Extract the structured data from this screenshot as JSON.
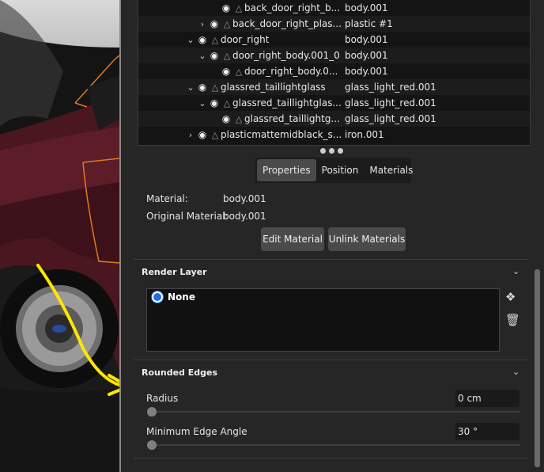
{
  "tree": {
    "rows": [
      {
        "indent": 3,
        "expand": "",
        "name": "back_door_right_b...",
        "material": "body.001"
      },
      {
        "indent": 2,
        "expand": "chevron-right",
        "name": "back_door_right_plas...",
        "material": "plastic #1"
      },
      {
        "indent": 1,
        "expand": "chevron-down",
        "name": "door_right",
        "material": "body.001"
      },
      {
        "indent": 2,
        "expand": "chevron-down",
        "name": "door_right_body.001_0",
        "material": "body.001"
      },
      {
        "indent": 3,
        "expand": "",
        "name": "door_right_body.0...",
        "material": "body.001"
      },
      {
        "indent": 1,
        "expand": "chevron-down",
        "name": "glassred_taillightglass",
        "material": "glass_light_red.001"
      },
      {
        "indent": 2,
        "expand": "chevron-down",
        "name": "glassred_taillightglas...",
        "material": "glass_light_red.001"
      },
      {
        "indent": 3,
        "expand": "",
        "name": "glassred_taillightg...",
        "material": "glass_light_red.001"
      },
      {
        "indent": 1,
        "expand": "chevron-right",
        "name": "plasticmattemidblack_s...",
        "material": "iron.001"
      }
    ]
  },
  "tabs": {
    "properties": "Properties",
    "position": "Position",
    "materials": "Materials"
  },
  "properties": {
    "material_label": "Material:",
    "material_value": "body.001",
    "original_material_label": "Original Material:",
    "original_material_value": "body.001",
    "edit_material": "Edit Material",
    "unlink_materials": "Unlink Materials"
  },
  "render_layer": {
    "title": "Render Layer",
    "selected": "None"
  },
  "rounded_edges": {
    "title": "Rounded Edges",
    "radius_label": "Radius",
    "radius_value": "0 cm",
    "radius_level": 0,
    "min_angle_label": "Minimum Edge Angle",
    "min_angle_value": "30 °",
    "min_angle_level": 0
  },
  "colors": {
    "accent": "#1e6fe6",
    "panel_bg": "#262626",
    "tree_bg": "#141414",
    "button_bg": "#4a4a4a",
    "annotation": "#ffe600"
  }
}
